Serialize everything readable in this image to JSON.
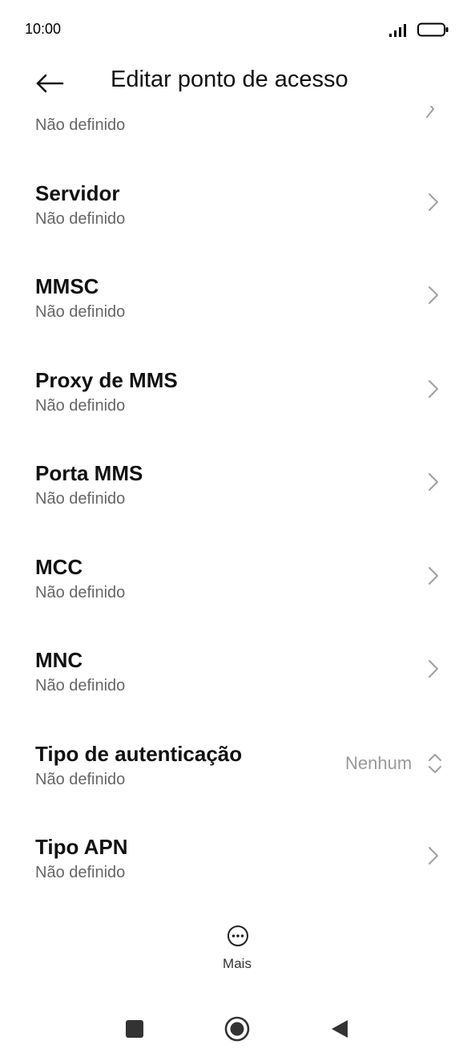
{
  "status_bar": {
    "time": "10:00",
    "icons": [
      "signal-icon",
      "battery-icon"
    ]
  },
  "header": {
    "title": "Editar ponto de acesso",
    "back_icon": "arrow-left-icon"
  },
  "partial_item": {
    "subtitle": "Não definido"
  },
  "items": [
    {
      "title": "Servidor",
      "subtitle": "Não definido"
    },
    {
      "title": "MMSC",
      "subtitle": "Não definido"
    },
    {
      "title": "Proxy de MMS",
      "subtitle": "Não definido"
    },
    {
      "title": "Porta MMS",
      "subtitle": "Não definido"
    },
    {
      "title": "MCC",
      "subtitle": "Não definido"
    },
    {
      "title": "MNC",
      "subtitle": "Não definido"
    },
    {
      "title": "Tipo de autenticação",
      "subtitle": "Não definido",
      "value": "Nenhum"
    },
    {
      "title": "Tipo APN",
      "subtitle": "Não definido"
    }
  ],
  "more": {
    "label": "Mais",
    "icon": "more-dots-icon"
  },
  "nav_bar": {
    "icons": [
      "square-icon",
      "circle-icon",
      "triangle-back-icon"
    ]
  },
  "colors": {
    "text_primary": "#111111",
    "text_secondary": "#666666",
    "value_text": "#999999",
    "chevron": "#a0a0a0"
  }
}
